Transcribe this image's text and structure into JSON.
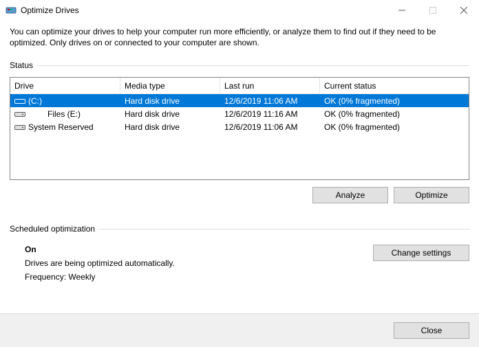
{
  "window": {
    "title": "Optimize Drives"
  },
  "intro": "You can optimize your drives to help your computer run more efficiently, or analyze them to find out if they need to be optimized. Only drives on or connected to your computer are shown.",
  "status": {
    "label": "Status",
    "columns": {
      "drive": "Drive",
      "media": "Media type",
      "last": "Last run",
      "status": "Current status"
    },
    "rows": [
      {
        "name": "(C:)",
        "media": "Hard disk drive",
        "last": "12/6/2019 11:06 AM",
        "status": "OK (0% fragmented)",
        "selected": true,
        "indent": false,
        "icon": "os-drive"
      },
      {
        "name": "Files (E:)",
        "media": "Hard disk drive",
        "last": "12/6/2019 11:16 AM",
        "status": "OK (0% fragmented)",
        "selected": false,
        "indent": true,
        "icon": "hdd"
      },
      {
        "name": "System Reserved",
        "media": "Hard disk drive",
        "last": "12/6/2019 11:06 AM",
        "status": "OK (0% fragmented)",
        "selected": false,
        "indent": false,
        "icon": "hdd"
      }
    ],
    "buttons": {
      "analyze": "Analyze",
      "optimize": "Optimize"
    }
  },
  "schedule": {
    "label": "Scheduled optimization",
    "on": "On",
    "desc": "Drives are being optimized automatically.",
    "freq": "Frequency: Weekly",
    "change": "Change settings"
  },
  "footer": {
    "close": "Close"
  }
}
